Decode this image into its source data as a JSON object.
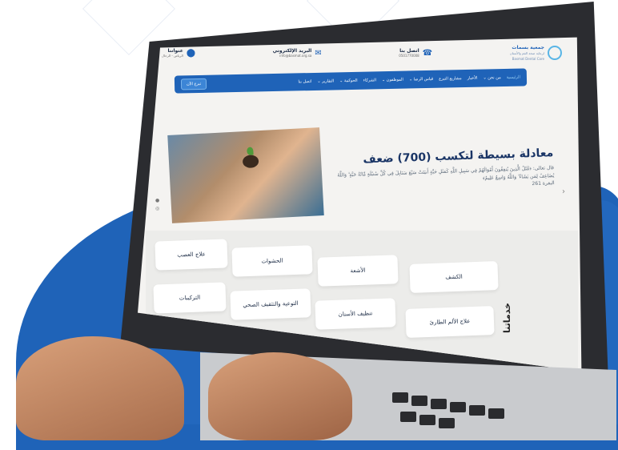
{
  "topbar": {
    "logo": {
      "title": "جمعية بسمات",
      "subtitle": "لرعاية صحة الفم والأسنان",
      "english": "Basmat Dental Care"
    },
    "contacts": [
      {
        "icon": "phone-icon",
        "title": "اتصل بنا",
        "value": "0501770008"
      },
      {
        "icon": "mail-icon",
        "title": "البريد الإلكتروني",
        "value": "info@basmat.org.sa"
      },
      {
        "icon": "location-icon",
        "title": "عنواننا",
        "value": "الرياض - الرحال"
      }
    ]
  },
  "nav": {
    "items": [
      {
        "label": "الرئيسية",
        "active": true
      },
      {
        "label": "من نحن ⌄"
      },
      {
        "label": "الأخبار"
      },
      {
        "label": "مشاريع التبرع"
      },
      {
        "label": "قياس الرضا ⌄"
      },
      {
        "label": "الموظفون ⌄"
      },
      {
        "label": "الشركاء"
      },
      {
        "label": "الحوكمة ⌄"
      },
      {
        "label": "التقارير ⌄"
      },
      {
        "label": "اتصل بنا"
      }
    ],
    "donate_label": "تبرع الآن"
  },
  "hero": {
    "title": "معادلة بسيطة لتكسب (700) ضعف",
    "body": "قال تعالى: ﴿مَّثَلُ الَّذِينَ يُنفِقُونَ أَمْوَالَهُمْ فِي سَبِيلِ اللَّهِ كَمَثَلِ حَبَّةٍ أَنبَتَتْ سَبْعَ سَنَابِلَ فِي كُلِّ سُنبُلَةٍ مِّائَةُ حَبَّةٍ ۗ وَاللَّهُ يُضَاعِفُ لِمَن يَشَاءُ ۗ وَاللَّهُ وَاسِعٌ عَلِيمٌ﴾",
    "reference": "البقرة 261"
  },
  "services": [
    {
      "label": "الكشف"
    },
    {
      "label": "الأشعة"
    },
    {
      "label": "الحشوات"
    },
    {
      "label": "علاج العصب"
    },
    {
      "label": "علاج الألم الطارئ"
    },
    {
      "label": "تنظيف الأسنان"
    },
    {
      "label": "التوعية والتثقيف الصحي"
    },
    {
      "label": "التركيبات"
    }
  ],
  "services_heading": "خدماتنا"
}
